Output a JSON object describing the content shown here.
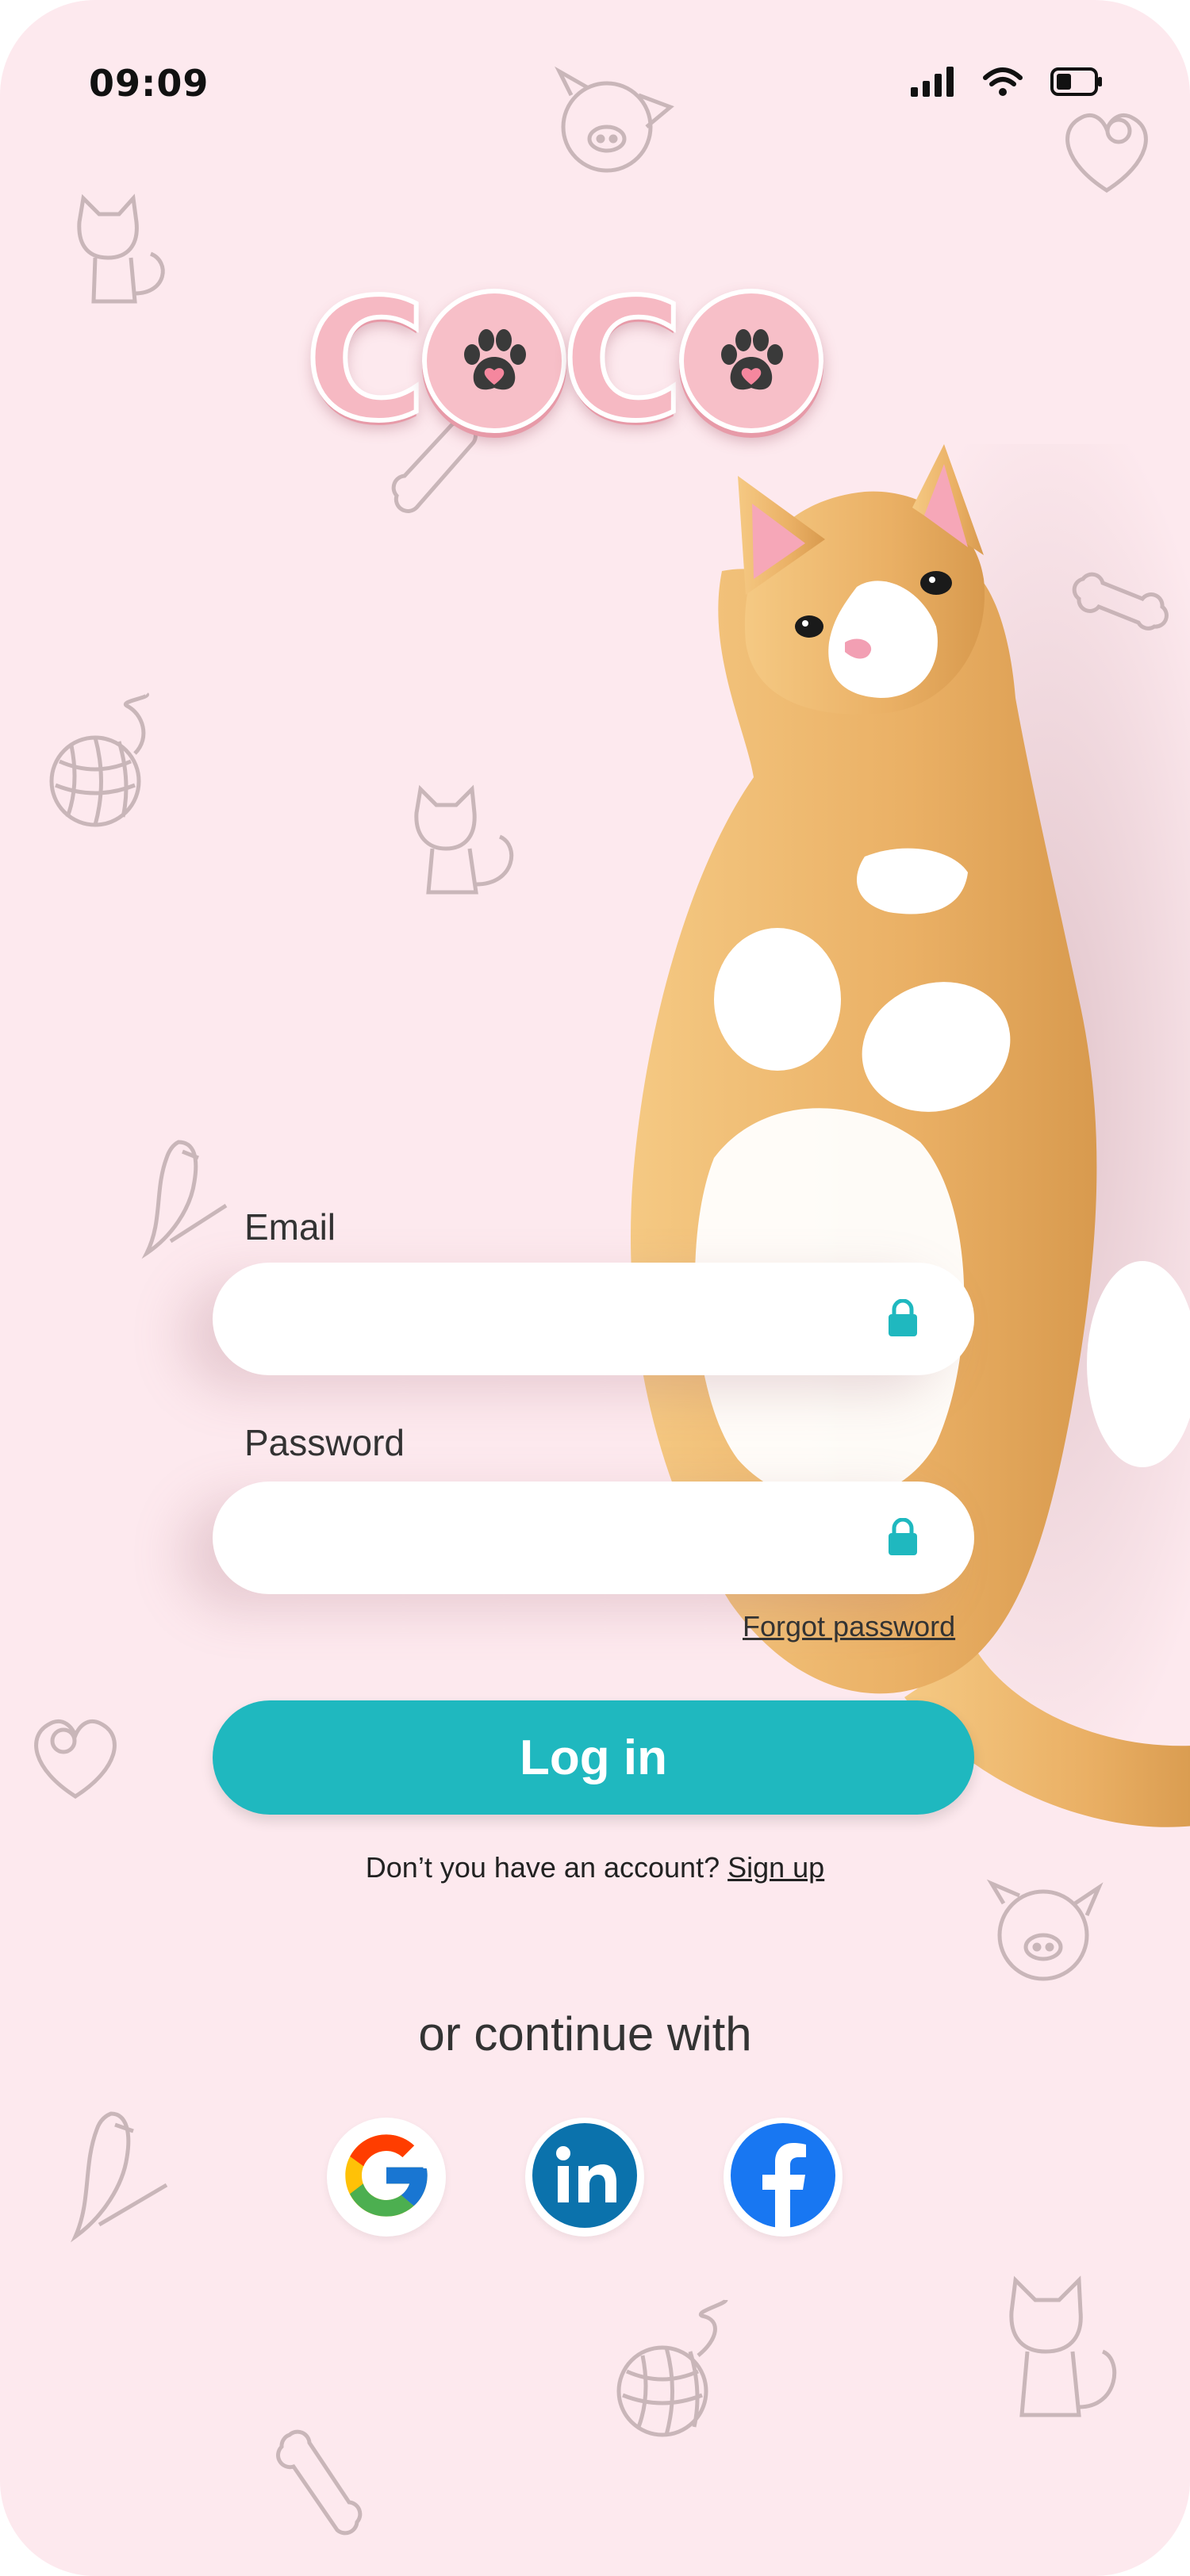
{
  "status_bar": {
    "time": "09:09"
  },
  "logo": {
    "letters": [
      "C",
      "C"
    ]
  },
  "form": {
    "email_label": "Email",
    "email_value": "",
    "password_label": "Password",
    "password_value": "",
    "forgot_label": "Forgot password",
    "login_label": "Log in",
    "signup_prompt": "Don’t you have an account?",
    "signup_link": "Sign up"
  },
  "social": {
    "heading": "or continue with",
    "providers": [
      "google-icon",
      "linkedin-icon",
      "facebook-icon"
    ]
  },
  "colors": {
    "background": "#fde9ee",
    "accent": "#1fb8bf",
    "logo_pink": "#f6b9c3",
    "text": "#333333"
  }
}
